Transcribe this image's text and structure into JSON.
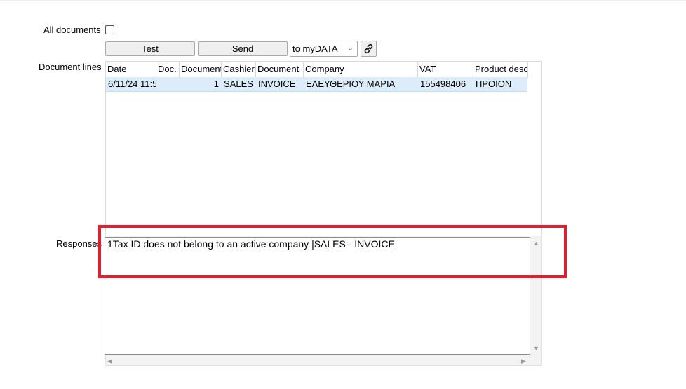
{
  "filters": {
    "all_documents_label": "All documents",
    "all_documents_checked": false
  },
  "toolbar": {
    "test_label": "Test",
    "send_label": "Send",
    "destination_selected": "to myDATA",
    "link_icon": "link-icon"
  },
  "document_lines": {
    "label": "Document lines",
    "columns": [
      "Date",
      "Doc.",
      "Document",
      "Cashier",
      "Document",
      "Company",
      "VAT",
      "Product desc"
    ],
    "rows": [
      [
        "6/11/24 11:5",
        "",
        "1",
        "SALES",
        "INVOICE",
        "ΕΛΕΥΘΕΡΙΟΥ ΜΑΡΙΑ",
        "155498406",
        "ΠΡΟΙΟΝ"
      ]
    ]
  },
  "responses": {
    "label": "Responses",
    "text": "1Tax ID does not belong to an active company |SALES - INVOICE"
  },
  "colors": {
    "highlight": "#e0202e",
    "row_selected": "#dcecfa"
  }
}
